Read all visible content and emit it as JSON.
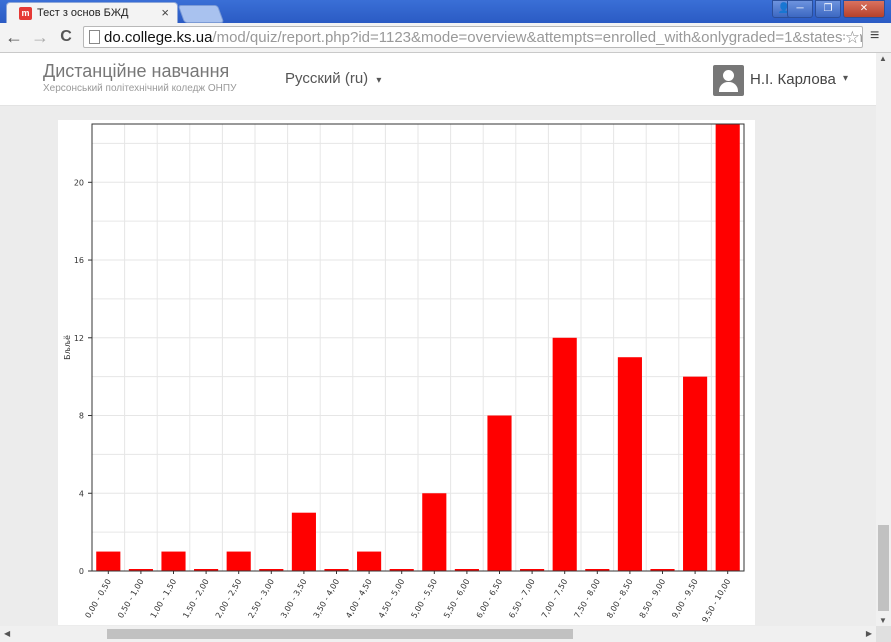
{
  "browser": {
    "tab_title": "Тест з основ БЖД",
    "favicon_text": "m",
    "tab_close": "×",
    "url_host": "do.college.ks.ua",
    "url_path": "/mod/quiz/report.php?id=1123&mode=overview&attempts=enrolled_with&onlygraded=1&states=inprogress",
    "back_icon": "←",
    "forward_icon": "→",
    "reload_icon": "C",
    "star_icon": "☆",
    "menu_icon": "≡",
    "win_minimize": "─",
    "win_maximize": "❐",
    "win_close": "✕",
    "win_user": "👤"
  },
  "header": {
    "site_name": "Дистанційне навчання",
    "site_subtitle": "Херсонський політехнічний коледж ОНПУ",
    "language": "Русский (ru)",
    "language_caret": "▾",
    "user_name": "Н.І. Карлова",
    "user_caret": "▾"
  },
  "scrollbars": {
    "up": "▲",
    "down": "▼",
    "left": "◀",
    "right": "▶"
  },
  "chart_data": {
    "type": "bar",
    "title": "",
    "xlabel": "",
    "ylabel": "Бљљё",
    "categories": [
      "0,00 - 0,50",
      "0,50 - 1,00",
      "1,00 - 1,50",
      "1,50 - 2,00",
      "2,00 - 2,50",
      "2,50 - 3,00",
      "3,00 - 3,50",
      "3,50 - 4,00",
      "4,00 - 4,50",
      "4,50 - 5,00",
      "5,00 - 5,50",
      "5,50 - 6,00",
      "6,00 - 6,50",
      "6,50 - 7,00",
      "7,00 - 7,50",
      "7,50 - 8,00",
      "8,00 - 8,50",
      "8,50 - 9,00",
      "9,00 - 9,50",
      "9,50 - 10,00"
    ],
    "values": [
      1,
      0,
      1,
      0,
      1,
      0,
      3,
      0,
      1,
      0,
      4,
      0,
      8,
      0,
      12,
      0,
      11,
      0,
      10,
      23
    ],
    "ylim": [
      0,
      23
    ],
    "yticks": [
      "0",
      "4",
      "8",
      "12",
      "16",
      "20"
    ],
    "bar_color": "#ff0000",
    "grid": true,
    "legend": "none"
  }
}
